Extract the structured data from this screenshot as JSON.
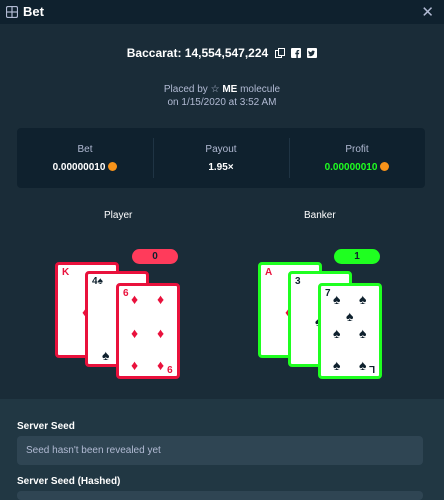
{
  "header": {
    "title": "Bet",
    "icon": "bet-icon",
    "close_icon": "close-icon",
    "close_glyph": "✕"
  },
  "game": {
    "line": "Baccarat: 14,554,547,224",
    "icons": [
      "copy-icon",
      "facebook-icon",
      "twitter-icon"
    ]
  },
  "placed": {
    "prefix": "Placed by",
    "user": "ME",
    "suffix": "molecule",
    "date": "on 1/15/2020 at 3:52 AM"
  },
  "stats": {
    "bet": {
      "label": "Bet",
      "value": "0.00000010"
    },
    "payout": {
      "label": "Payout",
      "value": "1.95×"
    },
    "profit": {
      "label": "Profit",
      "value": "0.00000010"
    },
    "coin_color": "#f7931a",
    "profit_color": "#1fff20"
  },
  "player": {
    "label": "Player",
    "score": "0",
    "cards": [
      {
        "rank": "K",
        "suit": "♦",
        "color": "red"
      },
      {
        "rank": "4",
        "suit": "♠",
        "color": "black"
      },
      {
        "rank": "6",
        "suit": "♦",
        "color": "red",
        "bottom_rank": "9"
      }
    ]
  },
  "banker": {
    "label": "Banker",
    "score": "1",
    "cards": [
      {
        "rank": "A",
        "suit": "♦",
        "color": "red"
      },
      {
        "rank": "3",
        "suit": "♠",
        "color": "black"
      },
      {
        "rank": "7",
        "suit": "♠",
        "color": "black",
        "bottom_rank": "L"
      }
    ]
  },
  "server_seed": {
    "label": "Server Seed",
    "placeholder": "Seed hasn't been revealed yet"
  },
  "server_seed_hashed": {
    "label": "Server Seed (Hashed)"
  },
  "colors": {
    "background": "#1a2c38",
    "panel": "#0f212e",
    "lose": "#e9113c",
    "win": "#1fff20"
  }
}
